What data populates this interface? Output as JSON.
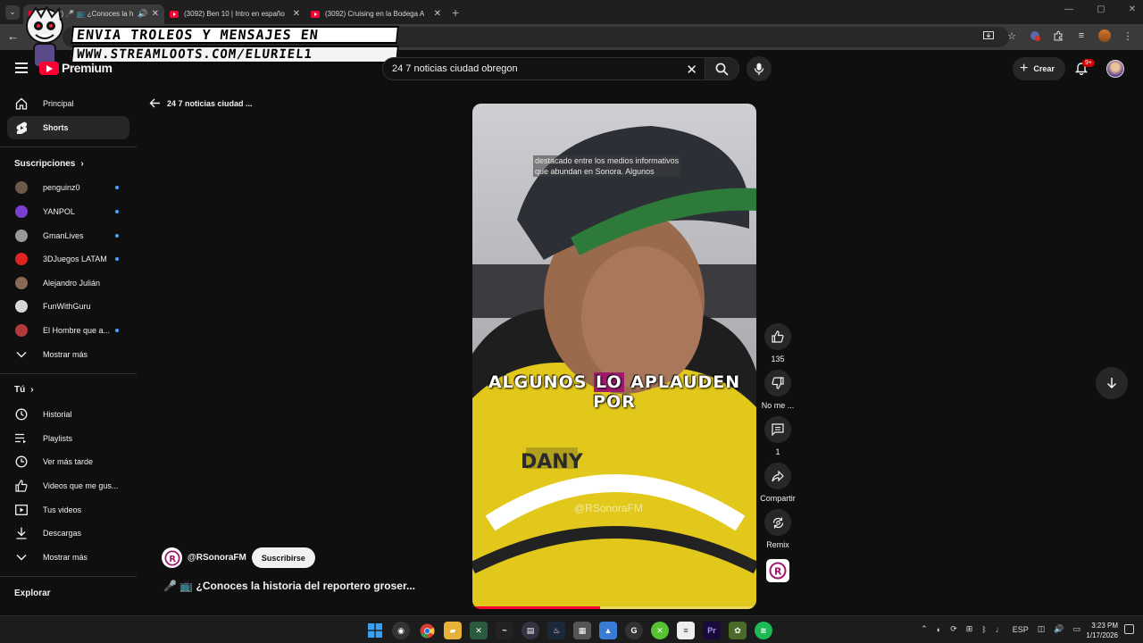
{
  "browser": {
    "tabs": [
      {
        "label": "(3092) 🎤 📺 ¿Conoces la h",
        "active": true
      },
      {
        "label": "(3092) Ben 10 | Intro en españo",
        "active": false
      },
      {
        "label": "(3092) Cruising en la Bodega A",
        "active": false
      }
    ],
    "new_tab": "+"
  },
  "overlay": {
    "line1": "ENVIA TROLEOS Y MENSAJES EN",
    "line2": "WWW.STREAMLOOTS.COM/ELURIEL1"
  },
  "header": {
    "logo_text": "Premium",
    "search_value": "24 7 noticias ciudad obregon",
    "create_label": "Crear",
    "notif_badge": "9+"
  },
  "sidebar": {
    "main": [
      {
        "label": "Principal",
        "icon": "home-icon"
      },
      {
        "label": "Shorts",
        "icon": "shorts-icon",
        "active": true
      }
    ],
    "subscriptions_title": "Suscripciones",
    "subscriptions": [
      {
        "label": "penguinz0",
        "color": "#6b5a4a",
        "dot": true
      },
      {
        "label": "YANPOL",
        "color": "#7a3fd1",
        "dot": true
      },
      {
        "label": "GmanLives",
        "color": "#9a9a9a",
        "dot": true
      },
      {
        "label": "3DJuegos LATAM",
        "color": "#e02424",
        "dot": true
      },
      {
        "label": "Alejandro Julián",
        "color": "#8a6a55",
        "dot": false
      },
      {
        "label": "FunWithGuru",
        "color": "#d8d8d8",
        "dot": false
      },
      {
        "label": "El Hombre que a...",
        "color": "#b33a3a",
        "dot": true
      }
    ],
    "subs_more": "Mostrar más",
    "you_title": "Tú",
    "you_items": [
      {
        "label": "Historial",
        "icon": "history-icon"
      },
      {
        "label": "Playlists",
        "icon": "playlists-icon"
      },
      {
        "label": "Ver más tarde",
        "icon": "watch-later-icon"
      },
      {
        "label": "Videos que me gus...",
        "icon": "like-icon"
      },
      {
        "label": "Tus videos",
        "icon": "your-videos-icon"
      },
      {
        "label": "Descargas",
        "icon": "download-icon"
      }
    ],
    "you_more": "Mostrar más",
    "explore_title": "Explorar"
  },
  "main": {
    "back_label": "24 7 noticias ciudad ...",
    "video": {
      "caption_top_1": "destacado entre los medios informativos",
      "caption_top_2": "que abundan en Sonora. Algunos",
      "caption_big_pre": "ALGUNOS ",
      "caption_big_hl": "LO",
      "caption_big_post": " APLAUDEN POR",
      "shirt_text": "DANY",
      "watermark": "@RSonoraFM",
      "progress": 0.45
    },
    "actions": {
      "likes": "135",
      "dislike": "No me ...",
      "comments": "1",
      "share": "Compartir",
      "remix": "Remix"
    },
    "channel": "@RSonoraFM",
    "subscribe": "Suscribirse",
    "title": "🎤 📺 ¿Conoces la historia del reportero groser..."
  },
  "taskbar": {
    "lang": "ESP",
    "time": "3:23 PM",
    "date": "1/17/2026"
  }
}
